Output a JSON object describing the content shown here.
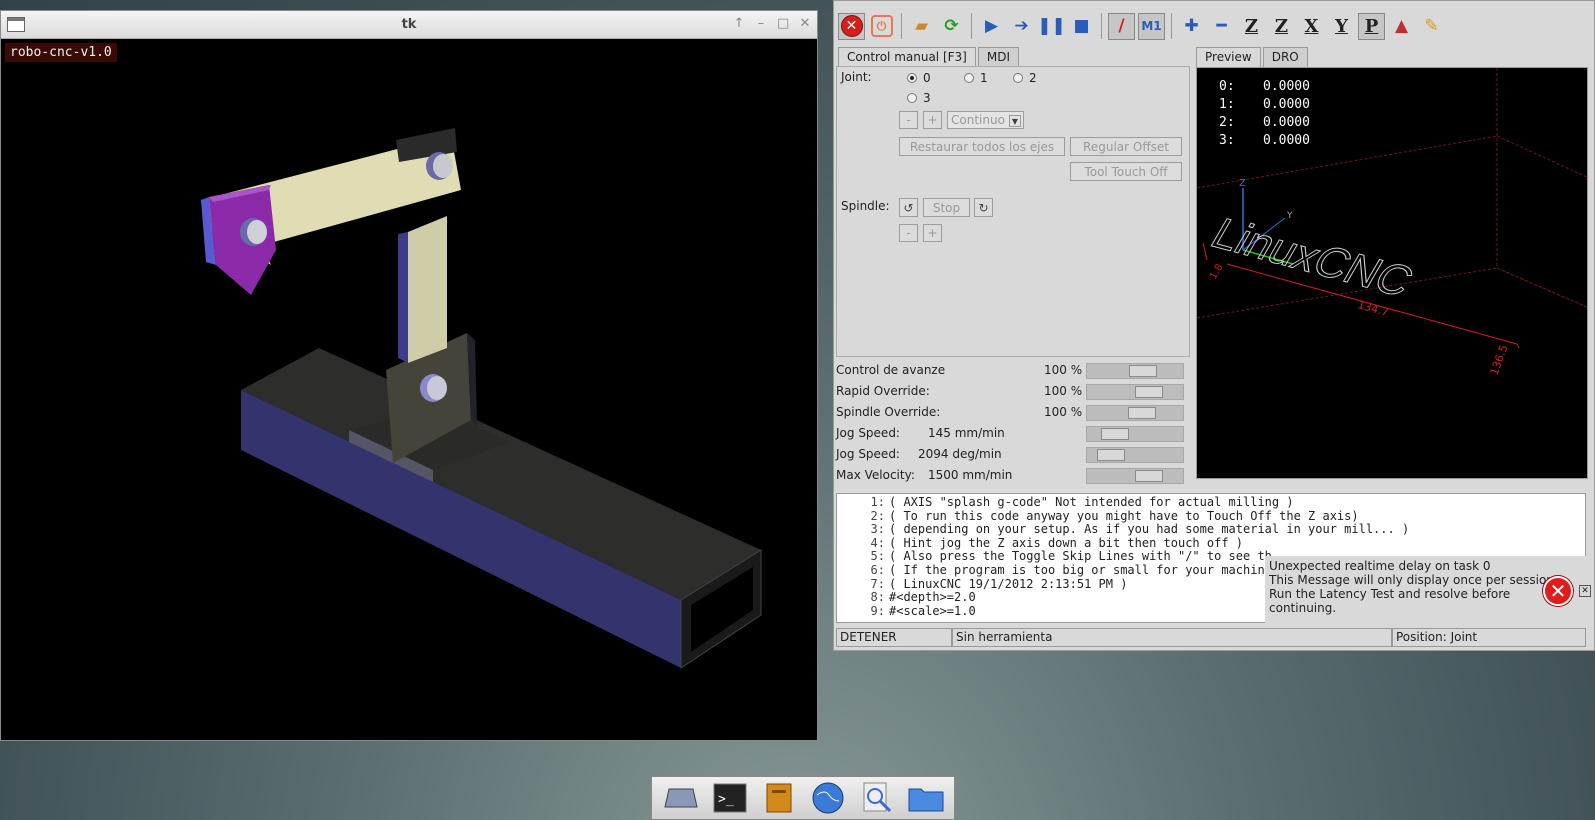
{
  "tk": {
    "title": "tk",
    "badge": "robo-cnc-v1.0",
    "controls": [
      "↑",
      "–",
      "□",
      "✕"
    ]
  },
  "axis": {
    "tabs_left": [
      "Control manual [F3]",
      "MDI"
    ],
    "tabs_right": [
      "Preview",
      "DRO"
    ],
    "manual": {
      "joint_label": "Joint:",
      "joints": [
        "0",
        "1",
        "2",
        "3"
      ],
      "selected_joint": "0",
      "minus": "-",
      "plus": "+",
      "jog_mode": "Continuo",
      "home_all": "Restaurar todos los ejes",
      "offset": "Regular Offset",
      "touch_off": "Tool Touch Off",
      "spindle_label": "Spindle:",
      "spindle_stop": "Stop"
    },
    "overrides": [
      {
        "label": "Control de avanze",
        "value": "100 %",
        "level": 0.62
      },
      {
        "label": "Rapid Override:",
        "value": "100 %",
        "level": 0.7
      },
      {
        "label": "Spindle Override:",
        "value": "100 %",
        "level": 0.6
      },
      {
        "label": "Jog Speed:",
        "value": "145 mm/min",
        "level": 0.2
      },
      {
        "label": "Jog Speed:",
        "value": "2094 deg/min",
        "level": 0.15
      },
      {
        "label": "Max Velocity:",
        "value": "1500 mm/min",
        "level": 0.7
      }
    ],
    "dro": [
      {
        "axis": "0:",
        "value": "0.0000"
      },
      {
        "axis": "1:",
        "value": "0.0000"
      },
      {
        "axis": "2:",
        "value": "0.0000"
      },
      {
        "axis": "3:",
        "value": "0.0000"
      }
    ],
    "preview_labels": {
      "z": "Z",
      "y": "Y",
      "x1": "1.8",
      "x_dim": "134.7",
      "y_dim": "136.5",
      "logo": "LinuxCNC"
    },
    "gcode": [
      {
        "n": "1:",
        "text": "( AXIS \"splash g-code\" Not intended for actual milling )"
      },
      {
        "n": "2:",
        "text": "( To run this code anyway you might have to Touch Off the Z axis)"
      },
      {
        "n": "3:",
        "text": "( depending on your setup. As if you had some material in your mill... )"
      },
      {
        "n": "4:",
        "text": "( Hint jog the Z axis down a bit then touch off )"
      },
      {
        "n": "5:",
        "text": "( Also press the Toggle Skip Lines with \"/\" to see th"
      },
      {
        "n": "6:",
        "text": "( If the program is too big or small for your machine"
      },
      {
        "n": "7:",
        "text": "( LinuxCNC 19/1/2012 2:13:51 PM )"
      },
      {
        "n": "8:",
        "text": "#<depth>=2.0"
      },
      {
        "n": "9:",
        "text": "#<scale>=1.0"
      }
    ],
    "notification": {
      "line1": "Unexpected realtime delay on task 0",
      "line2": "This Message will only display once per session.",
      "line3": "Run the Latency Test and resolve before continuing.",
      "close": "✕"
    },
    "status": {
      "state": "DETENER",
      "tool": "Sin herramienta",
      "position": "Position: Joint"
    },
    "colors": {
      "estop": "#d4201b",
      "toolbar_icon": "#2a5db8"
    }
  },
  "taskbar": {
    "items": [
      "desktop-icon",
      "terminal-icon",
      "files-icon",
      "browser-icon",
      "search-icon",
      "folder-icon"
    ]
  }
}
